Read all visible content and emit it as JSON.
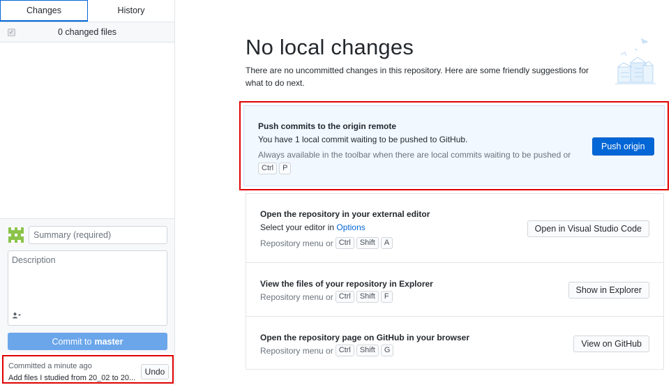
{
  "sidebar": {
    "tabs": [
      {
        "label": "Changes",
        "active": true
      },
      {
        "label": "History",
        "active": false
      }
    ],
    "files_count": "0 changed files",
    "commit": {
      "summary_placeholder": "Summary (required)",
      "description_placeholder": "Description",
      "button_prefix": "Commit to",
      "branch": "master"
    },
    "last_commit": {
      "time": "Committed a minute ago",
      "message": "Add files I studied from 20_02 to 20...",
      "undo_label": "Undo"
    }
  },
  "main": {
    "title": "No local changes",
    "subtitle": "There are no uncommitted changes in this repository. Here are some friendly suggestions for what to do next.",
    "push": {
      "title": "Push commits to the origin remote",
      "text": "You have 1 local commit waiting to be pushed to GitHub.",
      "hint": "Always available in the toolbar when there are local commits waiting to be pushed or",
      "keys": [
        "Ctrl",
        "P"
      ],
      "button": "Push origin"
    },
    "editor": {
      "title": "Open the repository in your external editor",
      "text_prefix": "Select your editor in",
      "link": "Options",
      "hint": "Repository menu or",
      "keys": [
        "Ctrl",
        "Shift",
        "A"
      ],
      "button": "Open in Visual Studio Code"
    },
    "explorer": {
      "title": "View the files of your repository in Explorer",
      "hint": "Repository menu or",
      "keys": [
        "Ctrl",
        "Shift",
        "F"
      ],
      "button": "Show in Explorer"
    },
    "github": {
      "title": "Open the repository page on GitHub in your browser",
      "hint": "Repository menu or",
      "keys": [
        "Ctrl",
        "Shift",
        "G"
      ],
      "button": "View on GitHub"
    }
  },
  "colors": {
    "accent": "#0366d6",
    "highlight_border": "#e00000",
    "push_card_bg": "#f1f8ff"
  }
}
